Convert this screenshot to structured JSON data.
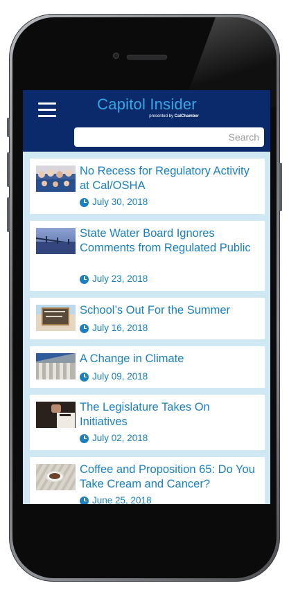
{
  "app": {
    "title": "Capitol Insider",
    "subtitle_prefix": "presented by",
    "subtitle_brand": "CalChamber",
    "menu_icon": "hamburger-menu-icon"
  },
  "search": {
    "placeholder": "Search",
    "value": ""
  },
  "colors": {
    "header_bg": "#0b2a6b",
    "title": "#35a7e6",
    "link": "#1a80c2",
    "list_bg": "#cfe8f4"
  },
  "articles": [
    {
      "title": "No Recess for Regulatory Activity at Cal/OSHA",
      "date": "July 30, 2018",
      "thumb": "group-photo"
    },
    {
      "title": "State Water Board Ignores Comments from Regulated Public",
      "date": "July 23, 2018",
      "thumb": "bridge-water"
    },
    {
      "title": "School’s Out For the Summer",
      "date": "July 16, 2018",
      "thumb": "chalkboard-summer-break"
    },
    {
      "title": "A Change in Climate",
      "date": "July 09, 2018",
      "thumb": "columns-building"
    },
    {
      "title": "The Legislature Takes On Initiatives",
      "date": "July 02, 2018",
      "thumb": "ballot-box"
    },
    {
      "title": "Coffee and Proposition 65: Do You Take Cream and Cancer?",
      "date": "June 25, 2018",
      "thumb": "coffee-cup"
    }
  ]
}
